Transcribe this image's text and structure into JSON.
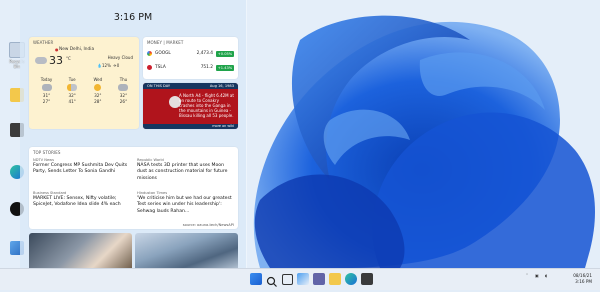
{
  "desktop": {
    "icons": [
      {
        "label": "Recycle Bin",
        "icon": "recycle-bin-icon"
      },
      {
        "label": "",
        "icon": "folder-icon"
      },
      {
        "label": "",
        "icon": "store-icon"
      },
      {
        "label": "",
        "icon": "edge-icon"
      },
      {
        "label": "",
        "icon": "github-icon"
      },
      {
        "label": "",
        "icon": "control-panel-icon"
      }
    ]
  },
  "widgets": {
    "time": "3:16 PM",
    "weather": {
      "title": "WEATHER",
      "location": "New Delhi, India",
      "temp": "33",
      "unit": "°C",
      "condition": "Heavy Cloud",
      "humidity": "12%",
      "wind": "0",
      "forecast": [
        {
          "day": "Today",
          "hi": "31°",
          "lo": "27°"
        },
        {
          "day": "Tue",
          "hi": "32°",
          "lo": "41°"
        },
        {
          "day": "Wed",
          "hi": "32°",
          "lo": "28°"
        },
        {
          "day": "Thu",
          "hi": "32°",
          "lo": "26°"
        }
      ]
    },
    "market": {
      "title": "MONEY | MARKET",
      "rows": [
        {
          "symbol": "GOOGL",
          "price": "2,473.4",
          "change": "+0.05%"
        },
        {
          "symbol": "TSLA",
          "price": "751.2",
          "change": "+1.43%"
        }
      ]
    },
    "on_this_day": {
      "title": "ON THIS DAY",
      "date": "Aug 16, 1983",
      "text": "A North A4 - flight 6.42M at en route to Conakry crashes into the Ganga in the mountains in Guinea - Bissau killing all 53 people.",
      "footer": "more on wiki"
    },
    "top_stories": {
      "title": "TOP STORIES",
      "items": [
        {
          "source": "NDTV News",
          "headline": "Former Congress MP Sushmita Dev Quits Party, Sends Letter To Sonia Gandhi"
        },
        {
          "source": "Republic World",
          "headline": "NASA tests 3D printer that uses Moon dust as construction material for future missions"
        },
        {
          "source": "Business Standard",
          "headline": "MARKET LIVE: Sensex, Nifty volatile; SpiceJet, Vodafone Idea slide 4% each"
        },
        {
          "source": "Hindustan Times",
          "headline": "'We criticise him but we had our greatest Test series win under his leadership': Sehwag lauds Rahan..."
        }
      ],
      "source_note": "source: oauna-tech/NewsAPI"
    }
  },
  "taskbar": {
    "icons": [
      "start-icon",
      "search-icon",
      "task-view-icon",
      "widgets-icon",
      "teams-icon",
      "file-explorer-icon",
      "edge-icon",
      "store-icon"
    ],
    "time": "3:16 PM",
    "date": "08/16/21"
  },
  "colors": {
    "accent": "#1a5fd1",
    "panel": "#dae8f7",
    "weather_card": "#fdf2d0",
    "on_this_day": "#b0141c",
    "market_up": "#1fa34a"
  }
}
